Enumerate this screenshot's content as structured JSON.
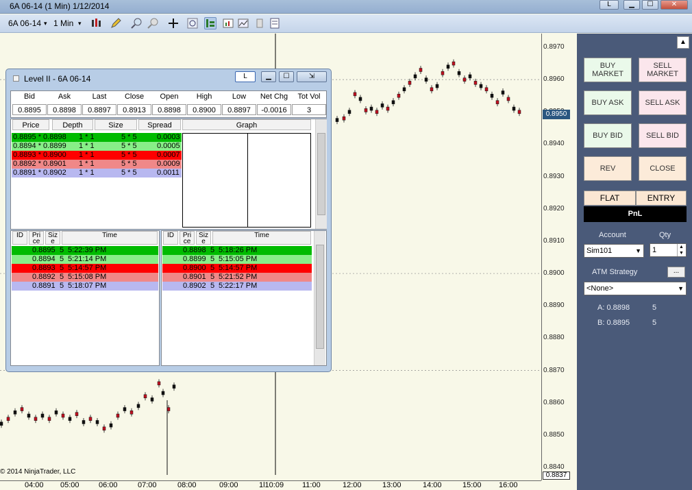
{
  "window": {
    "title": "6A 06-14 (1 Min)  1/12/2014",
    "btn_link": "L",
    "btn_min": "▁",
    "btn_max": "☐",
    "btn_close": "✕"
  },
  "toolbar": {
    "instrument": "6A 06-14",
    "instrument_arrow": "▾",
    "interval": "1 Min",
    "interval_arrow": "▾"
  },
  "chart": {
    "y_labels": [
      "0.8970",
      "0.8960",
      "0.8950",
      "0.8940",
      "0.8930",
      "0.8920",
      "0.8910",
      "0.8900",
      "0.8890",
      "0.8880",
      "0.8870",
      "0.8860",
      "0.8850",
      "0.8840"
    ],
    "x_labels": [
      "04:00",
      "05:00",
      "06:00",
      "07:00",
      "08:00",
      "09:00",
      "1l10:09",
      "11:00",
      "12:00",
      "13:00",
      "14:00",
      "15:00",
      "16:00"
    ],
    "current_price": "0.8950",
    "last_price": "0.8837",
    "copyright": "© 2014 NinjaTrader, LLC",
    "candle_up_color": "#111111",
    "candle_down_color": "#c01020"
  },
  "level2": {
    "title": "Level II - 6A 06-14",
    "btn_link": "L",
    "btn_min": "▁",
    "btn_max": "☐",
    "btn_close": "⇲",
    "summary_headers": [
      "Bid",
      "Ask",
      "Last",
      "Close",
      "Open",
      "High",
      "Low",
      "Net Chg",
      "Tot Vol"
    ],
    "summary_values": [
      "0.8895",
      "0.8898",
      "0.8897",
      "0.8913",
      "0.8898",
      "0.8900",
      "0.8897",
      "-0.0016",
      "3"
    ],
    "depth_headers": [
      "Price",
      "Depth",
      "Size",
      "Spread",
      "Graph"
    ],
    "depth_rows": [
      {
        "price": "0.8895 * 0.8898",
        "depth": "1 * 1",
        "size": "5 * 5",
        "spread": "0.0003",
        "color": "#00bb00"
      },
      {
        "price": "0.8894 * 0.8899",
        "depth": "1 * 1",
        "size": "5 * 5",
        "spread": "0.0005",
        "color": "#88ee88"
      },
      {
        "price": "0.8893 * 0.8900",
        "depth": "1 * 1",
        "size": "5 * 5",
        "spread": "0.0007",
        "color": "#ff0000"
      },
      {
        "price": "0.8892 * 0.8901",
        "depth": "1 * 1",
        "size": "5 * 5",
        "spread": "0.0009",
        "color": "#f08888"
      },
      {
        "price": "0.8891 * 0.8902",
        "depth": "1 * 1",
        "size": "5 * 5",
        "spread": "0.0011",
        "color": "#b8b8f0"
      }
    ],
    "tape_headers": {
      "id": "ID",
      "price": "Pri ce",
      "size": "Siz e",
      "time": "Time"
    },
    "bid_tape": [
      {
        "price": "0.8895",
        "size": "5",
        "time": "5:22:39 PM",
        "color": "#00bb00"
      },
      {
        "price": "0.8894",
        "size": "5",
        "time": "5:21:14 PM",
        "color": "#88ee88"
      },
      {
        "price": "0.8893",
        "size": "5",
        "time": "5:14:57 PM",
        "color": "#ff0000"
      },
      {
        "price": "0.8892",
        "size": "5",
        "time": "5:15:08 PM",
        "color": "#f08888"
      },
      {
        "price": "0.8891",
        "size": "5",
        "time": "5:18:07 PM",
        "color": "#b8b8f0"
      }
    ],
    "ask_tape": [
      {
        "price": "0.8898",
        "size": "5",
        "time": "5:18:26 PM",
        "color": "#00bb00"
      },
      {
        "price": "0.8899",
        "size": "5",
        "time": "5:15:05 PM",
        "color": "#88ee88"
      },
      {
        "price": "0.8900",
        "size": "5",
        "time": "5:14:57 PM",
        "color": "#ff0000"
      },
      {
        "price": "0.8901",
        "size": "5",
        "time": "5:21:52 PM",
        "color": "#f08888"
      },
      {
        "price": "0.8902",
        "size": "5",
        "time": "5:22:17 PM",
        "color": "#b8b8f0"
      }
    ]
  },
  "order_panel": {
    "buy_market": "BUY MARKET",
    "sell_market": "SELL MARKET",
    "buy_ask": "BUY ASK",
    "sell_ask": "SELL ASK",
    "buy_bid": "BUY BID",
    "sell_bid": "SELL BID",
    "rev": "REV",
    "close": "CLOSE",
    "flat": "FLAT",
    "entry": "ENTRY",
    "pnl": "PnL",
    "account_label": "Account",
    "qty_label": "Qty",
    "account_value": "Sim101",
    "qty_value": "1",
    "atm_label": "ATM Strategy",
    "atm_btn": "...",
    "atm_value": "<None>",
    "ask_label": "A: 0.8898",
    "ask_size": "5",
    "bid_label": "B: 0.8895",
    "bid_size": "5",
    "collapse_arrow": "▲"
  }
}
